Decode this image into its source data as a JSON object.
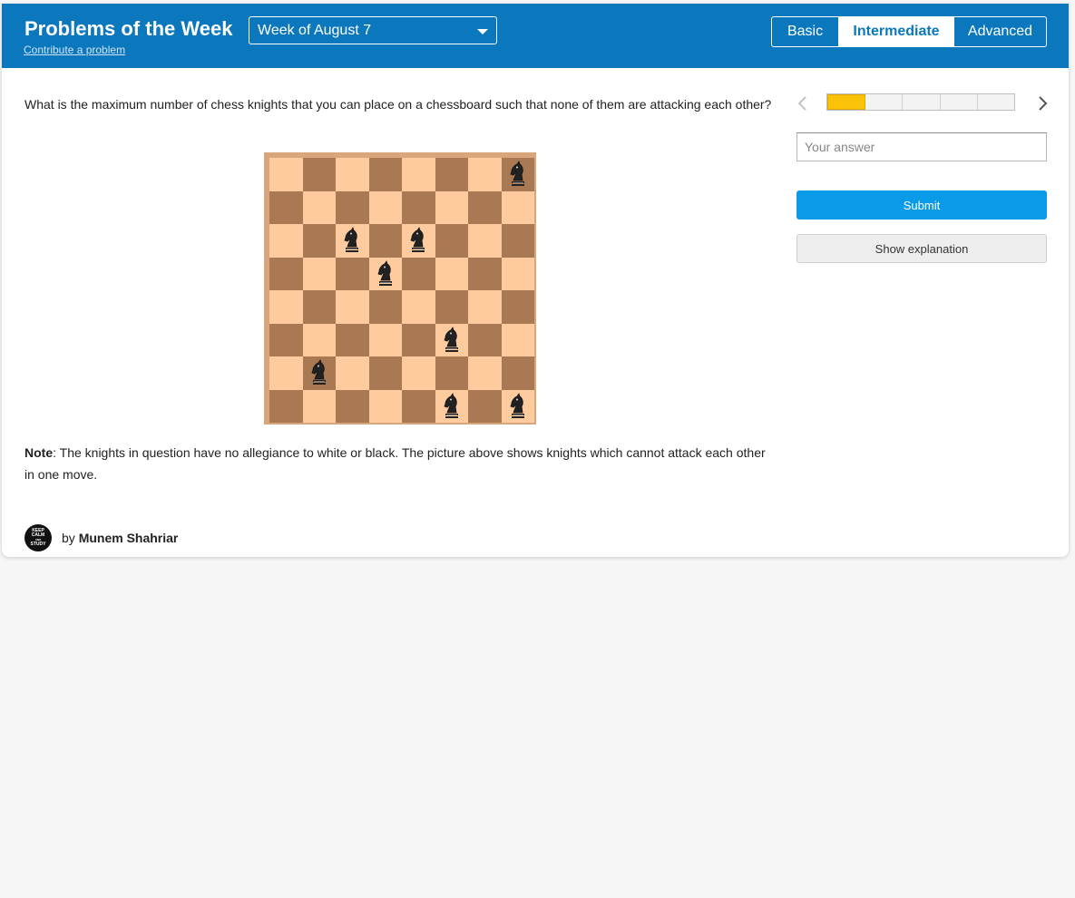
{
  "header": {
    "title": "Problems of the Week",
    "contribute_link": "Contribute a problem",
    "week_select": {
      "selected": "Week of August 7"
    },
    "levels": [
      {
        "label": "Basic",
        "active": false
      },
      {
        "label": "Intermediate",
        "active": true
      },
      {
        "label": "Advanced",
        "active": false
      }
    ]
  },
  "problem": {
    "question": "What is the maximum number of chess knights that you can place on a chessboard such that none of them are attacking each other?",
    "note_label": "Note",
    "note_text": ": The knights in question have no allegiance to white or black. The picture above shows knights which cannot attack each other in one move.",
    "board": {
      "light_color": "#fecb9e",
      "dark_color": "#a97953",
      "knight_icon": "black-knight-icon",
      "knights": [
        {
          "row": 1,
          "col": 8
        },
        {
          "row": 3,
          "col": 3
        },
        {
          "row": 3,
          "col": 5
        },
        {
          "row": 4,
          "col": 4
        },
        {
          "row": 6,
          "col": 6
        },
        {
          "row": 7,
          "col": 2
        },
        {
          "row": 8,
          "col": 6
        },
        {
          "row": 8,
          "col": 8
        }
      ]
    }
  },
  "author": {
    "by": "by",
    "name": "Munem Shahriar",
    "avatar_text": "KEEP CALM AND STUDY"
  },
  "sidebar": {
    "progress": {
      "segments": 5,
      "completed": 1,
      "completed_color": "#f9c30a"
    },
    "answer_placeholder": "Your answer",
    "submit_label": "Submit",
    "explain_label": "Show explanation"
  },
  "colors": {
    "header_bg": "#0b78be",
    "submit_bg": "#0a9be8"
  }
}
